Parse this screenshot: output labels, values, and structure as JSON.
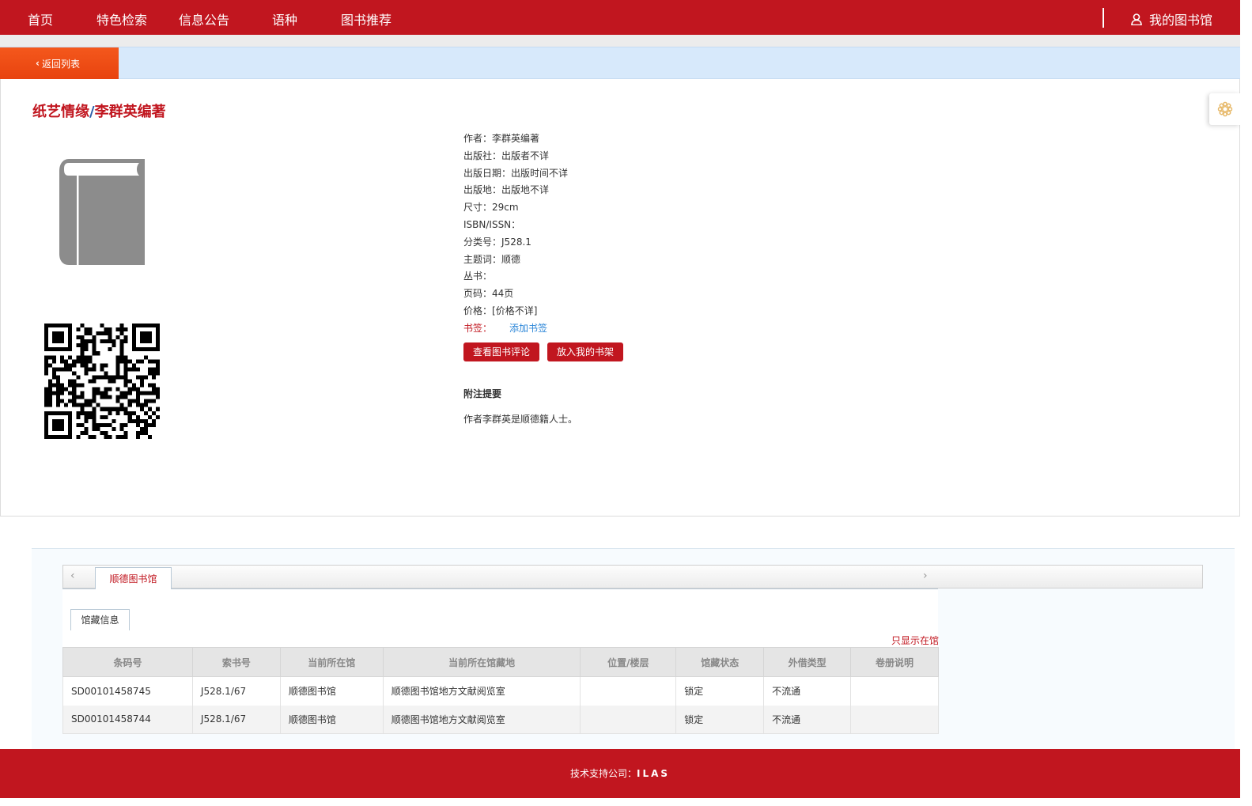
{
  "nav": {
    "items": [
      "首页",
      "特色检索",
      "信息公告",
      "语种",
      "图书推荐"
    ],
    "my_library": "我的图书馆"
  },
  "back_label": "返回列表",
  "book": {
    "title_main": "纸艺情缘",
    "title_slash": "/",
    "title_author": "李群英编著",
    "fields": [
      {
        "label": "作者：",
        "value": "李群英编著"
      },
      {
        "label": "出版社：",
        "value": "出版者不详"
      },
      {
        "label": "出版日期：",
        "value": "出版时间不详"
      },
      {
        "label": "出版地：",
        "value": "出版地不详"
      },
      {
        "label": "尺寸：",
        "value": "29cm"
      },
      {
        "label": "ISBN/ISSN：",
        "value": ""
      },
      {
        "label": "分类号：",
        "value": "J528.1"
      },
      {
        "label": "主题词：",
        "value": "顺德"
      },
      {
        "label": "丛书：",
        "value": ""
      },
      {
        "label": "页码：",
        "value": "44页"
      },
      {
        "label": "价格：",
        "value": "[价格不详]"
      }
    ],
    "bookmark_label": "书签：",
    "bookmark_link": "添加书签",
    "buttons": {
      "review": "查看图书评论",
      "shelf": "放入我的书架"
    },
    "notes_title": "附注提要",
    "notes_text": "作者李群英是顺德籍人士。"
  },
  "holdings": {
    "library_tab": "顺德图书馆",
    "sub_tab": "馆藏信息",
    "only_available": "只显示在馆",
    "columns": [
      "条码号",
      "索书号",
      "当前所在馆",
      "当前所在馆藏地",
      "位置/楼层",
      "馆藏状态",
      "外借类型",
      "卷册说明"
    ],
    "rows": [
      [
        "SD00101458745",
        "J528.1/67",
        "顺德图书馆",
        "顺德图书馆地方文献阅览室",
        "",
        "锁定",
        "不流通",
        ""
      ],
      [
        "SD00101458744",
        "J528.1/67",
        "顺德图书馆",
        "顺德图书馆地方文献阅览室",
        "",
        "锁定",
        "不流通",
        ""
      ]
    ]
  },
  "footer": {
    "label": "技术支持公司：",
    "brand": "ILAS"
  },
  "colors": {
    "primary": "#c1161f",
    "back_button": "#ee4c14",
    "link": "#2b86d8",
    "backbar": "#d7e9fb"
  },
  "icons": {
    "user": "user-icon",
    "book": "book-icon",
    "settings": "flower-settings-icon",
    "back": "chevron-left-icon"
  }
}
